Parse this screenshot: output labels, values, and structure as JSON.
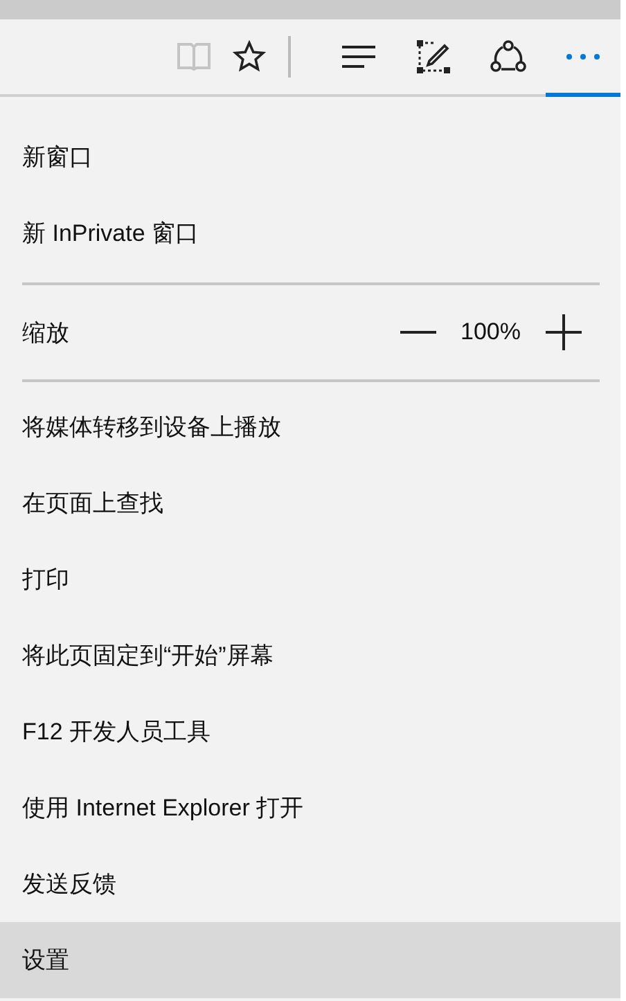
{
  "toolbar": {
    "buttons": [
      {
        "kind": "reading",
        "disabled": true,
        "selected": false
      },
      {
        "kind": "star",
        "disabled": false,
        "selected": false
      },
      {
        "kind": "separator"
      },
      {
        "kind": "hub",
        "disabled": false,
        "selected": false
      },
      {
        "kind": "note",
        "disabled": false,
        "selected": false
      },
      {
        "kind": "share",
        "disabled": false,
        "selected": false
      },
      {
        "kind": "more",
        "disabled": false,
        "selected": true
      }
    ]
  },
  "menu": [
    {
      "kind": "item",
      "label": "新窗口",
      "selected": false
    },
    {
      "kind": "item",
      "label": "新 InPrivate 窗口",
      "selected": false
    },
    {
      "kind": "divider"
    },
    {
      "kind": "zoom",
      "label": "缩放",
      "value": "100%"
    },
    {
      "kind": "divider"
    },
    {
      "kind": "item",
      "label": "将媒体转移到设备上播放",
      "selected": false
    },
    {
      "kind": "item",
      "label": "在页面上查找",
      "selected": false
    },
    {
      "kind": "item",
      "label": "打印",
      "selected": false
    },
    {
      "kind": "item",
      "label": "将此页固定到“开始”屏幕",
      "selected": false
    },
    {
      "kind": "item",
      "label": "F12 开发人员工具",
      "selected": false
    },
    {
      "kind": "item",
      "label": "使用 Internet Explorer 打开",
      "selected": false
    },
    {
      "kind": "item",
      "label": "发送反馈",
      "selected": false
    },
    {
      "kind": "item",
      "label": "设置",
      "selected": true
    }
  ]
}
